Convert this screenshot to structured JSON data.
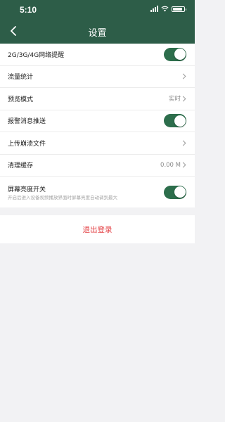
{
  "status_bar": {
    "time": "5:10",
    "battery_level": 0.85
  },
  "nav": {
    "title": "设置"
  },
  "settings": [
    {
      "label": "2G/3G/4G网络提醒",
      "control": "toggle",
      "on": true
    },
    {
      "label": "流量统计",
      "control": "chevron"
    },
    {
      "label": "预览模式",
      "control": "chevron",
      "value": "实时"
    },
    {
      "label": "报警消息推送",
      "control": "toggle",
      "on": true
    },
    {
      "label": "上传崩溃文件",
      "control": "chevron"
    },
    {
      "label": "清理缓存",
      "control": "chevron",
      "value": "0.00 M"
    },
    {
      "label": "屏幕亮度开关",
      "description": "开启后进入设备视频播放界面时屏幕亮度自动调到最大",
      "control": "toggle",
      "on": true
    }
  ],
  "logout": {
    "label": "退出登录"
  },
  "colors": {
    "header_bg": "#2d5d48",
    "toggle_on": "#2d6e4c",
    "logout_text": "#e2373b",
    "page_bg": "#f2f2f4"
  },
  "icons": [
    "back-icon",
    "chevron-right-icon",
    "signal-icon",
    "wifi-icon",
    "battery-icon"
  ]
}
